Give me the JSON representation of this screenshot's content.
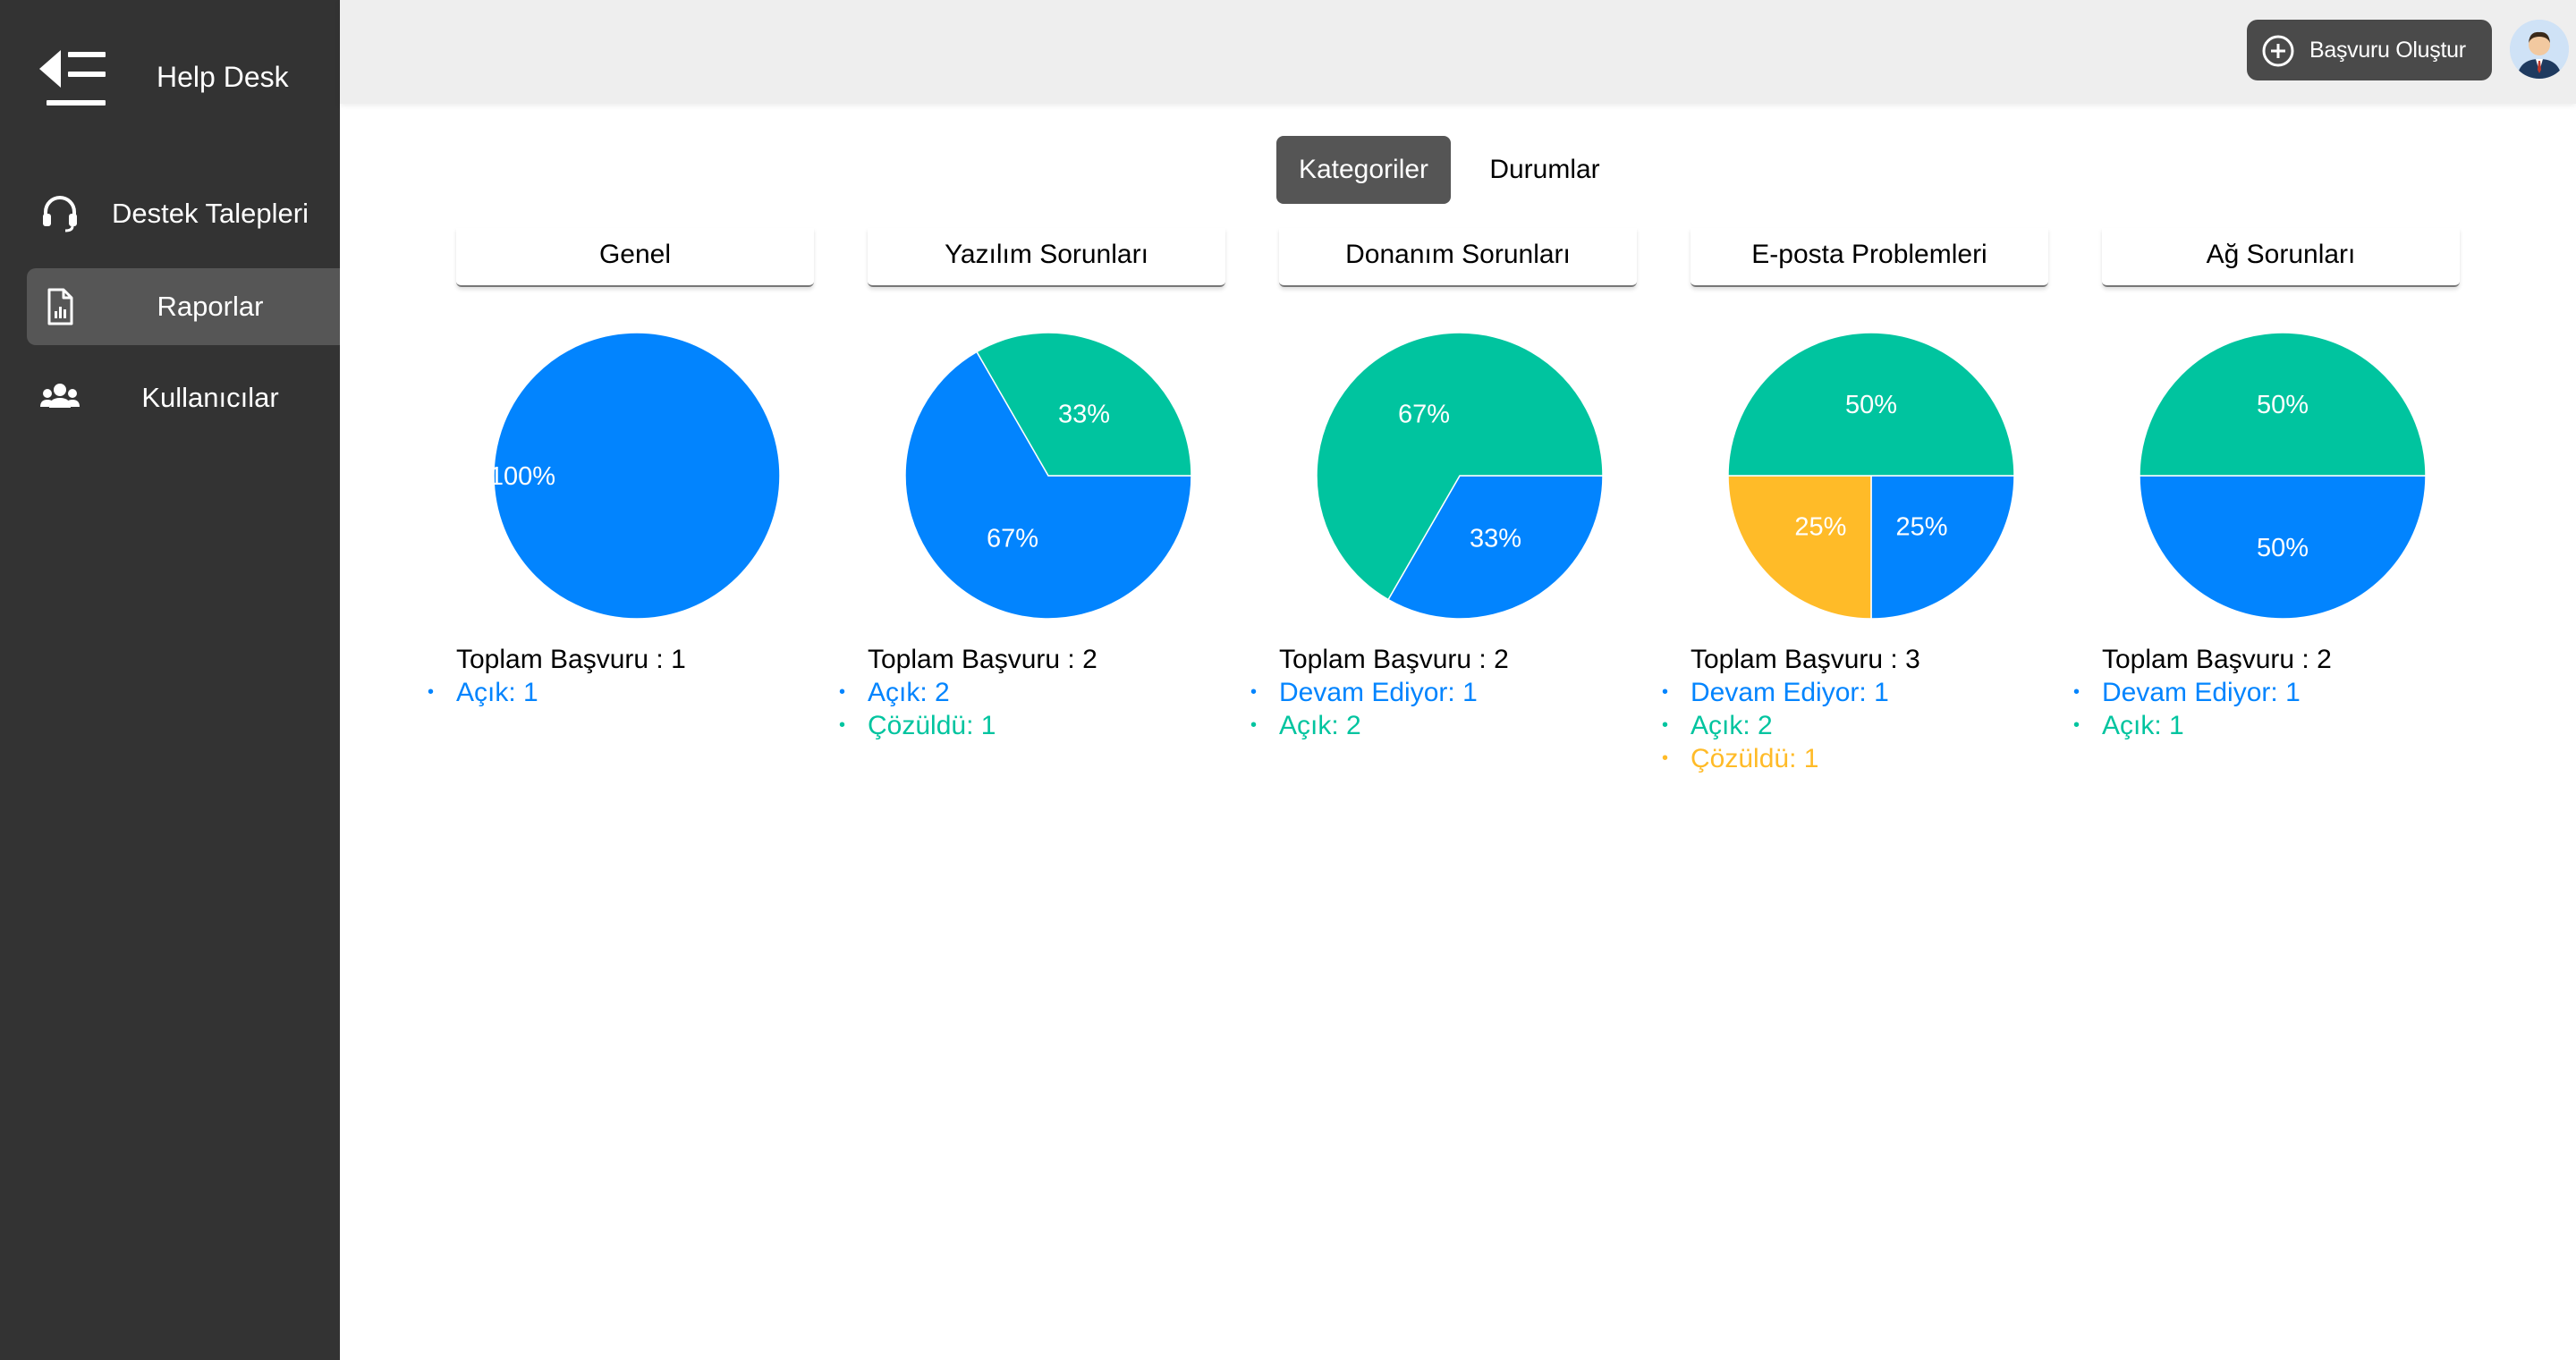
{
  "app": {
    "title": "Help Desk"
  },
  "sidebar": {
    "items": [
      {
        "label": "Destek Talepleri",
        "icon": "headset-icon",
        "active": false
      },
      {
        "label": "Raporlar",
        "icon": "report-icon",
        "active": true
      },
      {
        "label": "Kullanıcılar",
        "icon": "users-icon",
        "active": false
      }
    ]
  },
  "header": {
    "create_button_label": "Başvuru Oluştur"
  },
  "tabs": [
    {
      "label": "Kategoriler",
      "active": true
    },
    {
      "label": "Durumlar",
      "active": false
    }
  ],
  "colors": {
    "blue": "#0284FE",
    "green": "#00C49F",
    "yellow": "#FFBB28",
    "sidebar_bg": "#333333",
    "header_bg": "#EEEEEE"
  },
  "panels": [
    {
      "title": "Genel",
      "total_label": "Toplam Başvuru : 1",
      "items": [
        {
          "label": "Açık: 1",
          "color": "#0284FE"
        }
      ]
    },
    {
      "title": "Yazılım Sorunları",
      "total_label": "Toplam Başvuru : 2",
      "items": [
        {
          "label": "Açık: 2",
          "color": "#0284FE"
        },
        {
          "label": "Çözüldü: 1",
          "color": "#00C49F"
        }
      ]
    },
    {
      "title": "Donanım Sorunları",
      "total_label": "Toplam Başvuru : 2",
      "items": [
        {
          "label": "Devam Ediyor: 1",
          "color": "#0284FE"
        },
        {
          "label": "Açık: 2",
          "color": "#00C49F"
        }
      ]
    },
    {
      "title": "E-posta Problemleri",
      "total_label": "Toplam Başvuru : 3",
      "items": [
        {
          "label": "Devam Ediyor: 1",
          "color": "#0284FE"
        },
        {
          "label": "Açık: 2",
          "color": "#00C49F"
        },
        {
          "label": "Çözüldü: 1",
          "color": "#FFBB28"
        }
      ]
    },
    {
      "title": "Ağ Sorunları",
      "total_label": "Toplam Başvuru : 2",
      "items": [
        {
          "label": "Devam Ediyor: 1",
          "color": "#0284FE"
        },
        {
          "label": "Açık: 1",
          "color": "#00C49F"
        }
      ]
    }
  ],
  "chart_data": [
    {
      "type": "pie",
      "title": "Genel",
      "series": [
        {
          "name": "Açık",
          "value": 1,
          "percent_label": "100%",
          "color": "#0284FE"
        }
      ]
    },
    {
      "type": "pie",
      "title": "Yazılım Sorunları",
      "series": [
        {
          "name": "Açık",
          "value": 2,
          "percent_label": "67%",
          "color": "#0284FE"
        },
        {
          "name": "Çözüldü",
          "value": 1,
          "percent_label": "33%",
          "color": "#00C49F"
        }
      ]
    },
    {
      "type": "pie",
      "title": "Donanım Sorunları",
      "series": [
        {
          "name": "Devam Ediyor",
          "value": 1,
          "percent_label": "33%",
          "color": "#0284FE"
        },
        {
          "name": "Açık",
          "value": 2,
          "percent_label": "67%",
          "color": "#00C49F"
        }
      ]
    },
    {
      "type": "pie",
      "title": "E-posta Problemleri",
      "series": [
        {
          "name": "Devam Ediyor",
          "value": 1,
          "percent_label": "25%",
          "color": "#0284FE"
        },
        {
          "name": "Çözüldü",
          "value": 1,
          "percent_label": "25%",
          "color": "#FFBB28"
        },
        {
          "name": "Açık",
          "value": 2,
          "percent_label": "50%",
          "color": "#00C49F"
        }
      ]
    },
    {
      "type": "pie",
      "title": "Ağ Sorunları",
      "series": [
        {
          "name": "Devam Ediyor",
          "value": 1,
          "percent_label": "50%",
          "color": "#0284FE"
        },
        {
          "name": "Açık",
          "value": 1,
          "percent_label": "50%",
          "color": "#00C49F"
        }
      ]
    }
  ]
}
